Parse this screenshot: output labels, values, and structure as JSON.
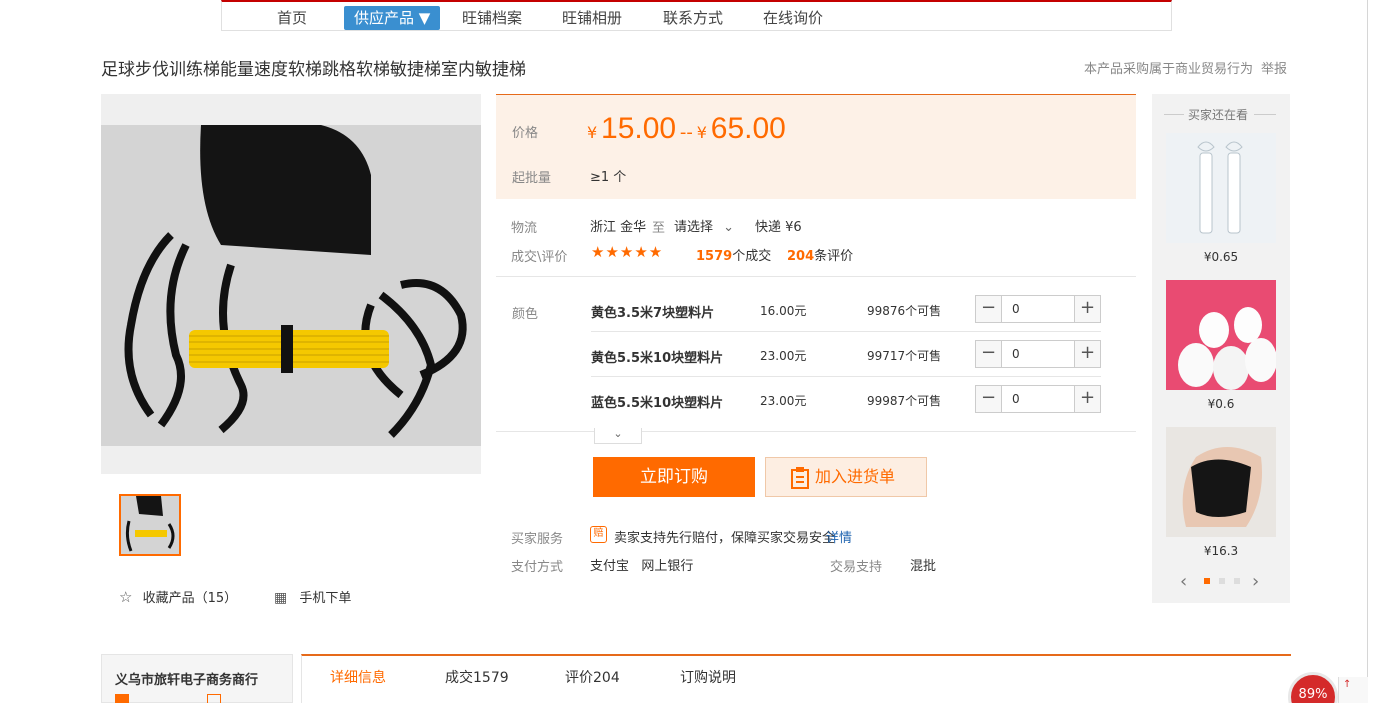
{
  "nav": {
    "items": [
      "首页",
      "供应产品 ▼",
      "旺铺档案",
      "旺铺相册",
      "联系方式",
      "在线询价"
    ]
  },
  "product": {
    "title": "足球步伐训练梯能量速度软梯跳格软梯敏捷梯室内敏捷梯",
    "trade_note": "本产品采购属于商业贸易行为",
    "report": "举报"
  },
  "price": {
    "label": "价格",
    "currency": "¥",
    "low": "15.00",
    "range_sep": "--",
    "high": "65.00",
    "moq_label": "起批量",
    "moq_value": "≥1 个"
  },
  "logistics": {
    "label": "物流",
    "from": "浙江 金华",
    "to_word": "至",
    "select": "请选择",
    "express": "快递 ¥6"
  },
  "deals": {
    "label": "成交\\评价",
    "stars": "★★★★★",
    "deal_count": "1579",
    "deal_unit": "个成交",
    "review_count": "204",
    "review_unit": "条评价"
  },
  "sku": {
    "label": "颜色",
    "rows": [
      {
        "name": "黄色3.5米7块塑料片",
        "price": "16.00元",
        "stock": "99876个可售",
        "qty": "0"
      },
      {
        "name": "黄色5.5米10块塑料片",
        "price": "23.00元",
        "stock": "99717个可售",
        "qty": "0"
      },
      {
        "name": "蓝色5.5米10块塑料片",
        "price": "23.00元",
        "stock": "99987个可售",
        "qty": "0"
      }
    ],
    "minus": "−",
    "plus": "+",
    "expand": "⌄"
  },
  "actions": {
    "buy": "立即订购",
    "cart": "加入进货单"
  },
  "services": {
    "buyer_label": "买家服务",
    "buyer_text": "卖家支持先行赔付，保障买家交易安全",
    "details": "详情",
    "pay_label": "支付方式",
    "pay_values": "支付宝   网上银行",
    "trade_label": "交易支持",
    "trade_value": "混批",
    "shield": "赔"
  },
  "gallery": {
    "fav": "收藏产品（15）",
    "mobile": "手机下单"
  },
  "side": {
    "title": "买家还在看",
    "items": [
      {
        "price": "¥0.65"
      },
      {
        "price": "¥0.6"
      },
      {
        "price": "¥16.3"
      }
    ]
  },
  "bottom": {
    "shop_name": "义乌市旅轩电子商务商行",
    "tabs": [
      "详细信息",
      "成交1579",
      "评价204",
      "订购说明"
    ]
  },
  "zoom": "89%",
  "colors": {
    "accent": "#ff6a00",
    "nav_active": "#3a8fd0"
  }
}
